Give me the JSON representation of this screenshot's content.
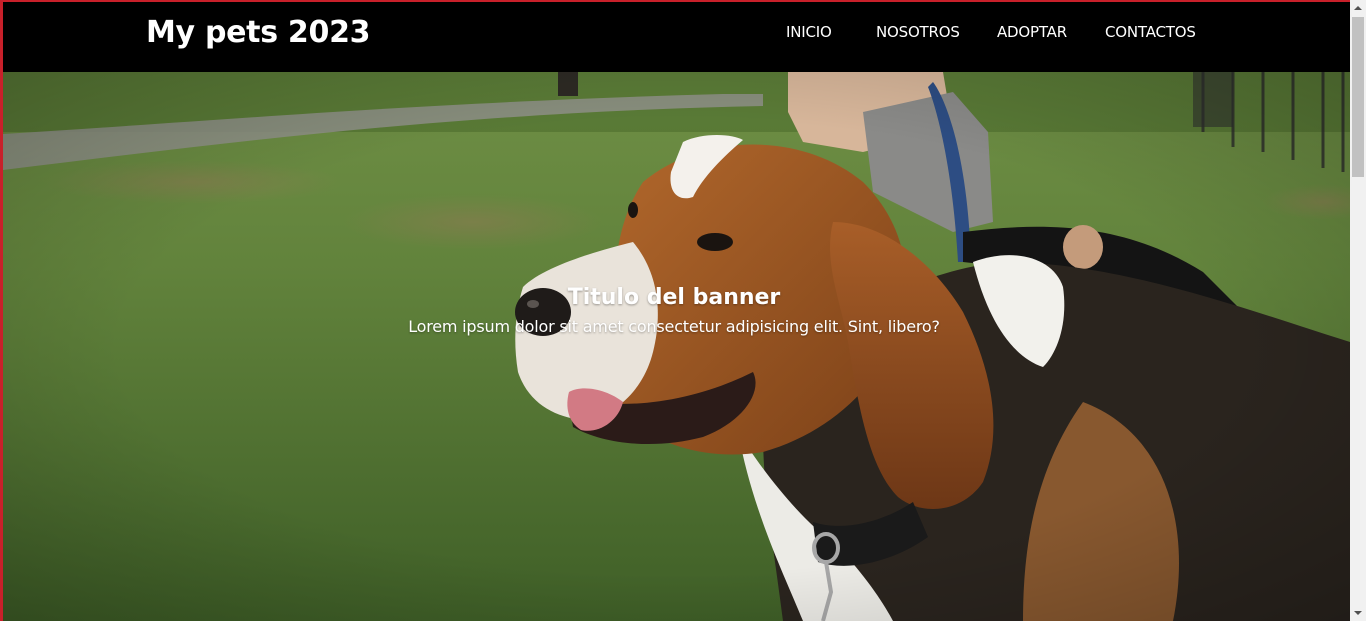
{
  "header": {
    "brand": "My pets 2023",
    "nav": [
      {
        "label": "INICIO"
      },
      {
        "label": "NOSOTROS"
      },
      {
        "label": "ADOPTAR"
      },
      {
        "label": "CONTACTOS"
      }
    ]
  },
  "banner": {
    "title": "Titulo del banner",
    "subtitle": "Lorem ipsum dolor sit amet consectetur adipisicing elit. Sint, libero?",
    "image": "beagle-on-grass-photo"
  },
  "colors": {
    "header_bg": "#000000",
    "header_text": "#ffffff",
    "page_border": "#c8202a",
    "grass": "#5d7d3c"
  }
}
